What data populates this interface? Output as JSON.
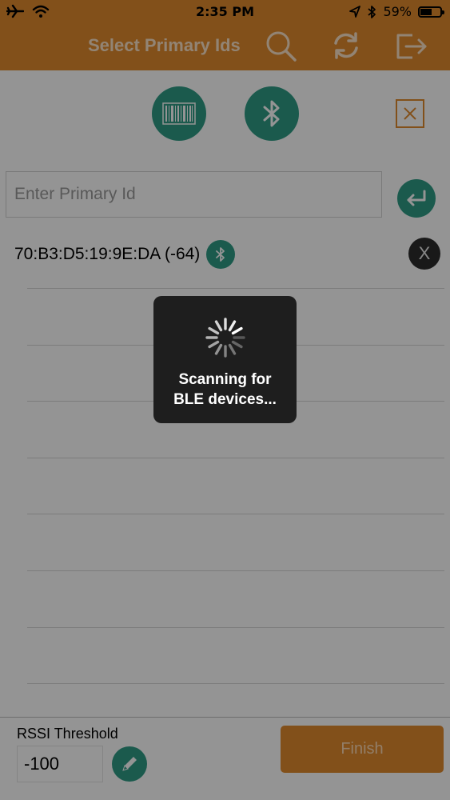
{
  "status_bar": {
    "time": "2:35 PM",
    "battery": "59%",
    "battery_level": 0.59
  },
  "nav": {
    "title": "Select Primary Ids",
    "icons": [
      "search-icon",
      "refresh-icon",
      "logout-icon"
    ]
  },
  "actions": {
    "icons": [
      "barcode-icon",
      "bluetooth-icon",
      "close-icon"
    ]
  },
  "input": {
    "placeholder": "Enter Primary Id",
    "value": ""
  },
  "devices": [
    {
      "label": "70:B3:D5:19:9E:DA (-64)",
      "remove_label": "X"
    }
  ],
  "loading": {
    "line1": "Scanning for",
    "line2": "BLE devices..."
  },
  "footer": {
    "rssi_label": "RSSI Threshold",
    "rssi_value": "-100",
    "finish_label": "Finish"
  },
  "colors": {
    "accent": "#e08a2e",
    "teal": "#2f9c86",
    "hud": "#1e1e1e"
  }
}
